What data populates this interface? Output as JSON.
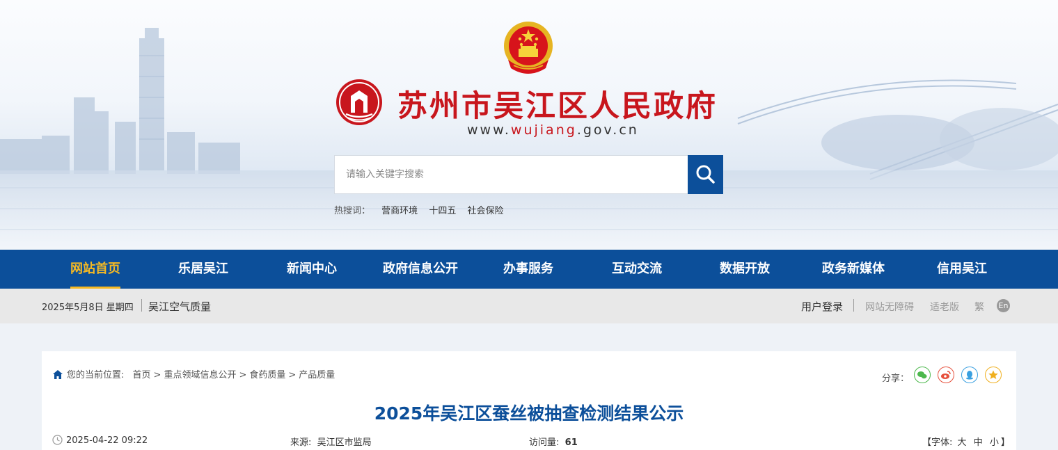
{
  "header": {
    "site_name": "苏州市吴江区人民政府",
    "site_url_prefix": "www.",
    "site_url_domain": "wujiang",
    "site_url_suffix": ".gov.cn",
    "search_placeholder": "请输入关键字搜索",
    "hot_label": "热搜词：",
    "hot_words": [
      "营商环境",
      "十四五",
      "社会保险"
    ]
  },
  "nav": {
    "items": [
      "网站首页",
      "乐居吴江",
      "新闻中心",
      "政府信息公开",
      "办事服务",
      "互动交流",
      "数据开放",
      "政务新媒体",
      "信用吴江"
    ],
    "active_index": 0
  },
  "infobar": {
    "date": "2025年5月8日 星期四",
    "air_quality": "吴江空气质量",
    "login": "用户登录",
    "accessibility": "网站无障碍",
    "elderly": "适老版",
    "traditional": "繁",
    "english": "En"
  },
  "article": {
    "breadcrumb_label": "您的当前位置:",
    "breadcrumb": [
      "首页",
      "重点领域信息公开",
      "食药质量",
      "产品质量"
    ],
    "share_label": "分享：",
    "title": "2025年吴江区蚕丝被抽查检测结果公示",
    "date": "2025-04-22 09:22",
    "source_label": "来源:",
    "source": "吴江区市监局",
    "views_label": "访问量:",
    "views": "61",
    "font_label": "【字体:",
    "font_large": "大",
    "font_medium": "中",
    "font_small": "小",
    "font_close": "】"
  },
  "colors": {
    "brand_blue": "#0c4f9a",
    "brand_red": "#c8161d",
    "active_nav": "#f5b923"
  }
}
